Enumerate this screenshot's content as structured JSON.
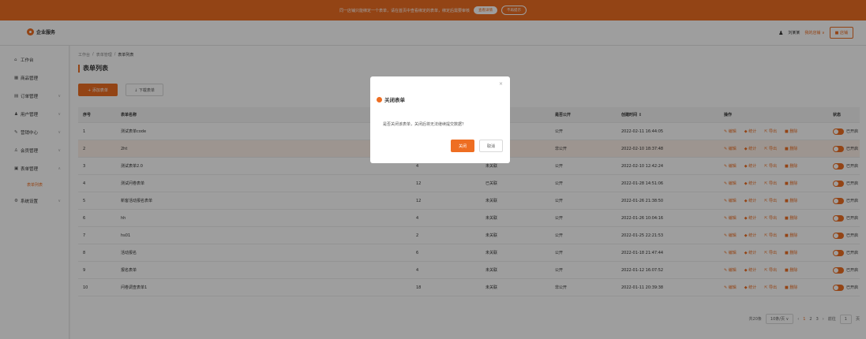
{
  "banner": {
    "text": "同一店铺只能绑定一个表单，请在首页中查看绑定的表单，绑定后需要审核",
    "primary_button": "查看详情",
    "secondary_button": "不再提示"
  },
  "topbar": {
    "logo_text": "企业服务",
    "username": "刘某某",
    "shop_label": "我的店铺 ∨",
    "store_button": "■ 店铺"
  },
  "sidebar": {
    "items": [
      {
        "icon": "⌂",
        "label": "工作台",
        "chevron": ""
      },
      {
        "icon": "▦",
        "label": "商品管理",
        "chevron": ""
      },
      {
        "icon": "▤",
        "label": "订单管理",
        "chevron": "∨"
      },
      {
        "icon": "♟",
        "label": "用户管理",
        "chevron": "∨"
      },
      {
        "icon": "✎",
        "label": "营销中心",
        "chevron": "∨"
      },
      {
        "icon": "♙",
        "label": "会员管理",
        "chevron": "∨"
      },
      {
        "icon": "▣",
        "label": "表单管理",
        "chevron": "∧"
      }
    ],
    "subitem": "表单列表",
    "last_item": {
      "icon": "⚙",
      "label": "系统设置",
      "chevron": "∨"
    }
  },
  "breadcrumb": [
    "工作台",
    "表单管理",
    "表单列表"
  ],
  "page_title": "表单列表",
  "buttons": {
    "add": "+ 添加表单",
    "download": "↓ 下载表单"
  },
  "table": {
    "headers": [
      "序号",
      "表单名称",
      "",
      "",
      "是否公开",
      "创建时间 ↕",
      "操作",
      "状态"
    ],
    "ops": [
      "✎ 编辑",
      "◆ 统计",
      "⇱ 导出",
      "■ 删除"
    ],
    "switch_label": "已开启",
    "rows": [
      {
        "no": "1",
        "name": "测试表单code",
        "c2": "",
        "c3": "",
        "c4": "公开",
        "time": "2022-02-11 16:44:05"
      },
      {
        "no": "2",
        "name": "2ht",
        "c2": "",
        "c3": "",
        "c4": "非公开",
        "time": "2022-02-10 18:37:48"
      },
      {
        "no": "3",
        "name": "测试表单2.0",
        "c2": "4",
        "c3": "未关联",
        "c4": "公开",
        "time": "2022-02-10 12:42:24"
      },
      {
        "no": "4",
        "name": "测试问卷表单",
        "c2": "12",
        "c3": "已关联",
        "c4": "公开",
        "time": "2022-01-28 14:51:06"
      },
      {
        "no": "5",
        "name": "新客活动报名表单",
        "c2": "12",
        "c3": "未关联",
        "c4": "公开",
        "time": "2022-01-26 21:38:50"
      },
      {
        "no": "6",
        "name": "hh",
        "c2": "4",
        "c3": "未关联",
        "c4": "公开",
        "time": "2022-01-26 10:04:16"
      },
      {
        "no": "7",
        "name": "hs01",
        "c2": "2",
        "c3": "未关联",
        "c4": "公开",
        "time": "2022-01-25 22:21:53"
      },
      {
        "no": "8",
        "name": "活动报名",
        "c2": "6",
        "c3": "未关联",
        "c4": "公开",
        "time": "2022-01-18 21:47:44"
      },
      {
        "no": "9",
        "name": "报名表单",
        "c2": "4",
        "c3": "未关联",
        "c4": "公开",
        "time": "2022-01-12 16:07:52"
      },
      {
        "no": "10",
        "name": "问卷调查表单1",
        "c2": "18",
        "c3": "未关联",
        "c4": "非公开",
        "time": "2022-01-11 20:39:38"
      }
    ]
  },
  "pager": {
    "total": "共20条",
    "size": "10条/页 ∨",
    "prev": "‹",
    "p1": "1",
    "p2": "2",
    "p3": "3",
    "next": "›",
    "goto": "前往",
    "page": "1",
    "unit": "页"
  },
  "modal": {
    "title": "关闭表单",
    "body": "是否关闭该表单，关闭后将无法继续提交数据？",
    "ok": "关闭",
    "cancel": "取消",
    "close": "×"
  },
  "colors": {
    "accent": "#ee6e22"
  }
}
